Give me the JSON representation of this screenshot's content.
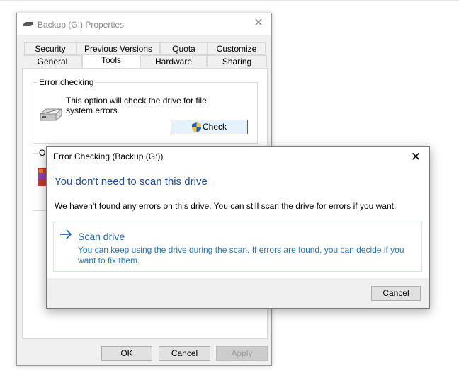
{
  "properties_window": {
    "title": "Backup (G:) Properties",
    "tabs_row1": [
      "Security",
      "Previous Versions",
      "Quota",
      "Customize"
    ],
    "tabs_row2": [
      "General",
      "Tools",
      "Hardware",
      "Sharing"
    ],
    "selected_tab": "Tools",
    "error_checking": {
      "group_label": "Error checking",
      "description": "This option will check the drive for file system errors.",
      "check_button": "Check"
    },
    "optimize_group_label_partial": "Op",
    "buttons": {
      "ok": "OK",
      "cancel": "Cancel",
      "apply": "Apply"
    }
  },
  "error_dialog": {
    "title": "Error Checking (Backup (G:))",
    "heading": "You don't need to scan this drive",
    "message": "We haven't found any errors on this drive. You can still scan the drive for errors if you want.",
    "scan_option": {
      "title": "Scan drive",
      "description": "You can keep using the drive during the scan. If errors are found, you can decide if you want to fix them."
    },
    "cancel_button": "Cancel"
  },
  "icons": {
    "title_drive": "drive-icon",
    "close": "close-icon",
    "check_shield": "uac-shield-icon",
    "scan_arrow": "arrow-right-icon"
  },
  "colors": {
    "heading_blue": "#1e4b9b",
    "link_blue": "#1e64b4",
    "accent_border": "#0078d7"
  }
}
